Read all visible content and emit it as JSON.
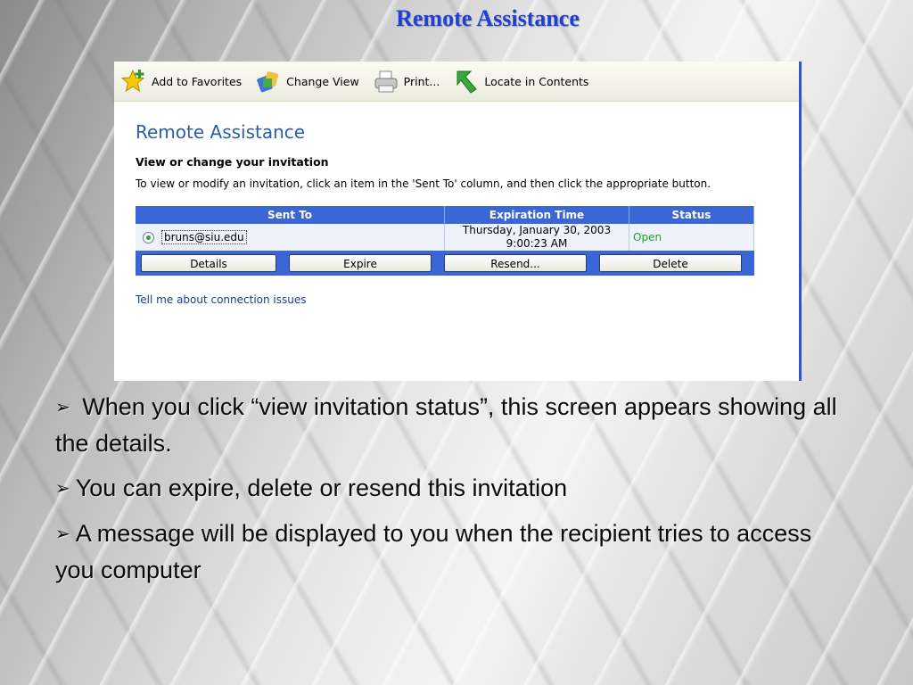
{
  "slide": {
    "title": "Remote Assistance",
    "bullets": [
      {
        "marker": "➢",
        "text": " When you click “view invitation status”, this screen appears showing all the details."
      },
      {
        "marker": "➢",
        "text": "You can expire, delete or resend this invitation"
      },
      {
        "marker": "➢",
        "text": "A message will be displayed to you when the recipient tries to access you computer"
      }
    ]
  },
  "toolbar": {
    "items": [
      {
        "label": "Add to Favorites",
        "icon": "star-plus-icon"
      },
      {
        "label": "Change View",
        "icon": "change-view-icon"
      },
      {
        "label": "Print...",
        "icon": "printer-icon"
      },
      {
        "label": "Locate in Contents",
        "icon": "locate-arrow-icon"
      }
    ]
  },
  "panel": {
    "heading": "Remote Assistance",
    "subheading": "View or change your invitation",
    "description": "To view or modify an invitation, click an item in the 'Sent To' column, and then click the appropriate button.",
    "link": "Tell me about connection issues"
  },
  "table": {
    "headers": [
      "Sent To",
      "Expiration Time",
      "Status"
    ],
    "rows": [
      {
        "sent_to": "bruns@siu.edu",
        "expiration_line1": "Thursday, January 30, 2003",
        "expiration_line2": "9:00:23 AM",
        "status": "Open"
      }
    ],
    "buttons": [
      "Details",
      "Expire",
      "Resend...",
      "Delete"
    ]
  },
  "colors": {
    "title": "#1f3fd6",
    "heading": "#2c5ea8",
    "table_header": "#3a66d6",
    "status_open": "#2a9a2a"
  }
}
